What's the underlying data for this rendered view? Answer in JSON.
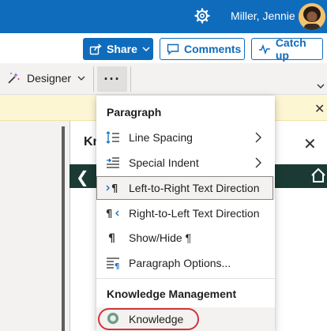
{
  "topbar": {
    "user_name": "Miller, Jennie",
    "icons": [
      "gear-icon",
      "avatar"
    ]
  },
  "commands": {
    "share": "Share",
    "comments": "Comments",
    "catch_up": "Catch up"
  },
  "ribbon": {
    "designer": "Designer",
    "more": "···"
  },
  "pane": {
    "title": "Kn"
  },
  "menu": {
    "header_paragraph": "Paragraph",
    "items": [
      {
        "label": "Line Spacing",
        "icon": "line-spacing-icon",
        "submenu": true
      },
      {
        "label": "Special Indent",
        "icon": "special-indent-icon",
        "submenu": true
      },
      {
        "label": "Left-to-Right Text Direction",
        "icon": "ltr-direction-icon",
        "submenu": false,
        "selected": true
      },
      {
        "label": "Right-to-Left Text Direction",
        "icon": "rtl-direction-icon",
        "submenu": false
      },
      {
        "label": "Show/Hide ¶",
        "icon": "pilcrow-icon",
        "submenu": false
      },
      {
        "label": "Paragraph Options...",
        "icon": "paragraph-options-icon",
        "submenu": false
      }
    ],
    "header_knowledge": "Knowledge Management",
    "knowledge_item": {
      "label": "Knowledge",
      "icon": "knowledge-icon"
    }
  },
  "colors": {
    "brand": "#0f6cbd",
    "highlight_ring": "#d13438",
    "pane_toolbar": "#1b3a34"
  }
}
